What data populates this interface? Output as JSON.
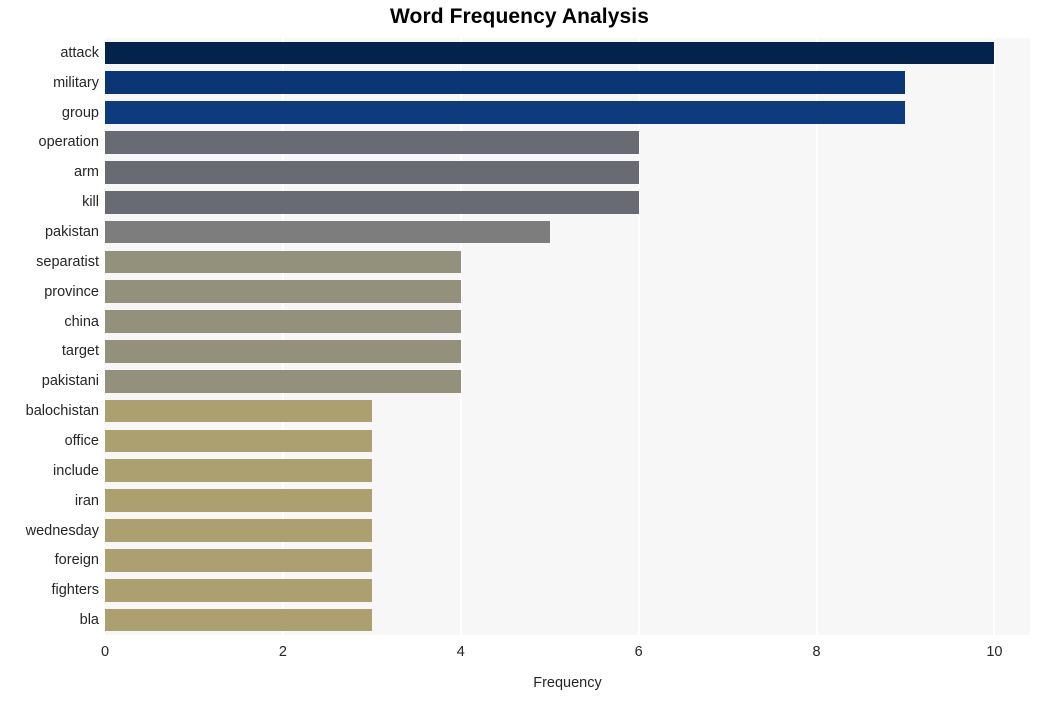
{
  "chart_data": {
    "type": "bar",
    "orientation": "horizontal",
    "title": "Word Frequency Analysis",
    "xlabel": "Frequency",
    "ylabel": "",
    "xlim": [
      0,
      10.4
    ],
    "ylim": [
      0,
      20
    ],
    "xticks": [
      0,
      2,
      4,
      6,
      8,
      10
    ],
    "xtick_labels": [
      "0",
      "2",
      "4",
      "6",
      "8",
      "10"
    ],
    "grid": "vertical",
    "legend": "none",
    "categories": [
      "attack",
      "military",
      "group",
      "operation",
      "arm",
      "kill",
      "pakistan",
      "separatist",
      "province",
      "china",
      "target",
      "pakistani",
      "balochistan",
      "office",
      "include",
      "iran",
      "wednesday",
      "foreign",
      "fighters",
      "bla"
    ],
    "values": [
      10,
      9,
      9,
      6,
      6,
      6,
      5,
      4,
      4,
      4,
      4,
      4,
      3,
      3,
      3,
      3,
      3,
      3,
      3,
      3
    ],
    "bar_colors": [
      "#03224c",
      "#0b3675",
      "#0d3b7d",
      "#686b74",
      "#686b74",
      "#686b74",
      "#7d7d7d",
      "#93907b",
      "#93907b",
      "#93907b",
      "#93907b",
      "#93907b",
      "#ac9f70",
      "#ac9f70",
      "#ac9f70",
      "#ac9f70",
      "#ac9f70",
      "#ac9f70",
      "#ac9f70",
      "#ac9f70"
    ],
    "plot_background": "#f7f7f7",
    "gridline_color": "#ffffff",
    "figure_background": "#ffffff",
    "text_color": "#262626"
  }
}
